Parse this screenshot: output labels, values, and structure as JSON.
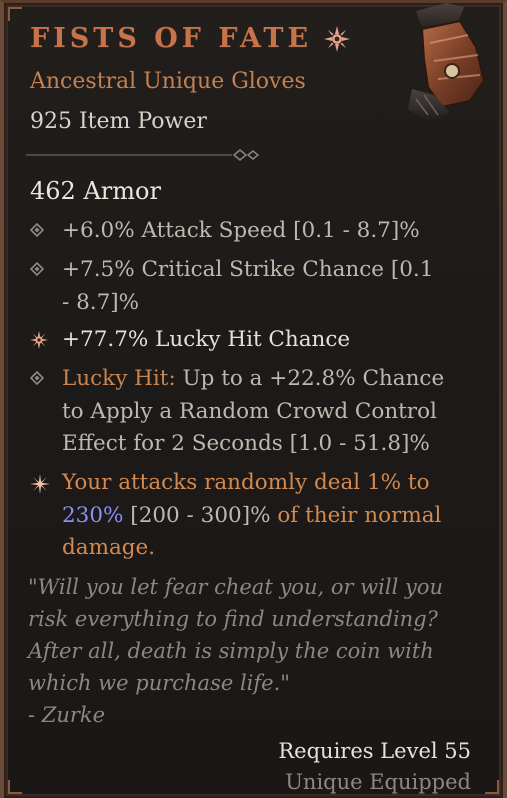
{
  "item": {
    "name": "FISTS OF FATE",
    "type": "Ancestral Unique Gloves",
    "item_power": "925 Item Power",
    "armor": "462 Armor"
  },
  "affixes": [
    {
      "text": "+6.0% Attack Speed [0.1 - 8.7]%"
    },
    {
      "text": "+7.5% Critical Strike Chance [0.1 - 8.7]%"
    },
    {
      "text": "+77.7% Lucky Hit Chance"
    },
    {
      "label": "Lucky Hit:",
      "text": " Up to a +22.8% Chance to Apply a Random Crowd Control Effect for 2 Seconds [1.0 - 51.8]%"
    }
  ],
  "unique_power": {
    "text_before": "Your attacks randomly deal 1% to ",
    "value": "230%",
    "range": " [200 - 300]%",
    "text_after": " of their normal damage."
  },
  "flavor": {
    "quote": "\"Will you let fear cheat you, or will you risk everything to find understanding? After all, death is simply the coin with which we purchase life.\"",
    "author": "- Zurke"
  },
  "footer": {
    "requires": "Requires Level 55",
    "equipped": "Unique Equipped"
  },
  "colors": {
    "title": "#c8744a",
    "unique": "#d38a50",
    "value_blue": "#8c8ff2",
    "text": "#bfb8ae"
  },
  "icons": {
    "unique": "unique-sun-icon",
    "affix": "diamond-bullet-icon",
    "implicit": "star-burst-icon",
    "item": "glove-icon"
  }
}
